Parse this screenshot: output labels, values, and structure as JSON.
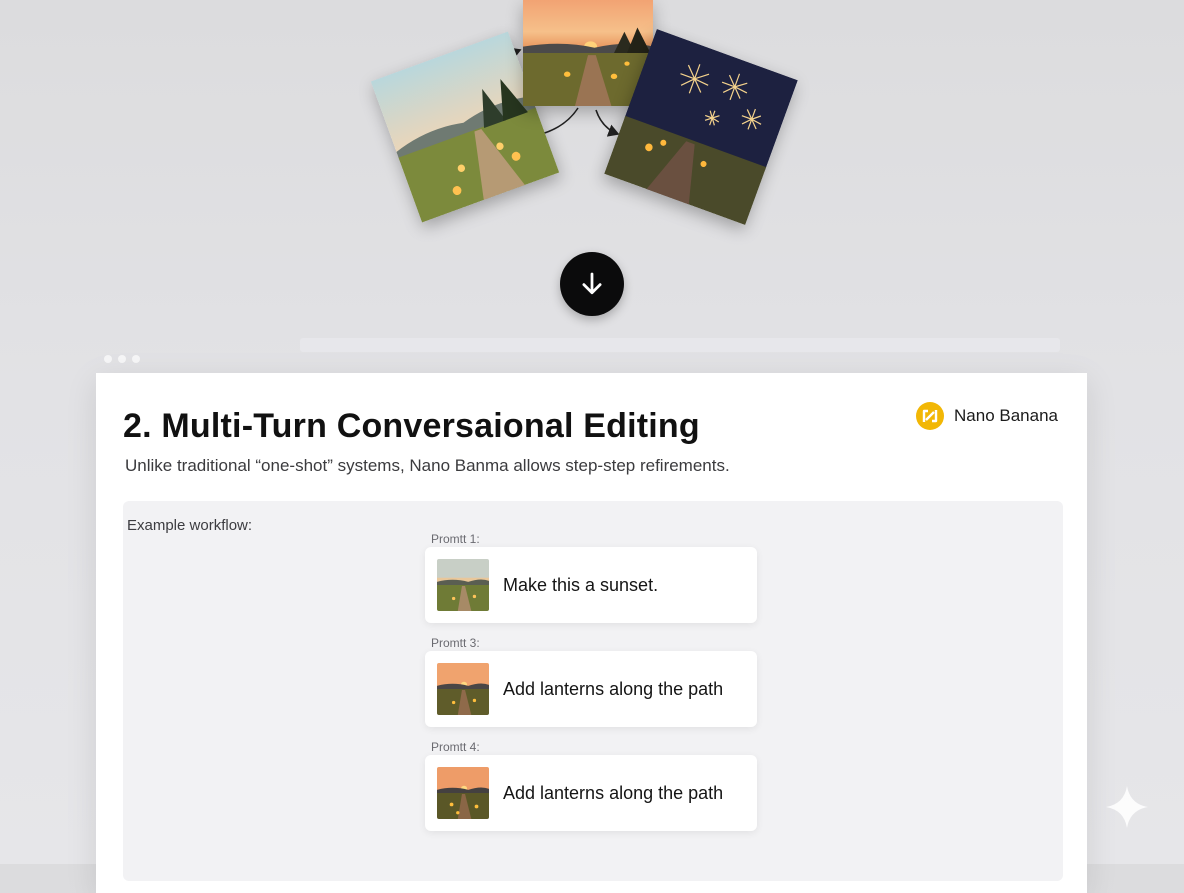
{
  "hero": {
    "images": [
      {
        "name": "original-photo"
      },
      {
        "name": "sunset-photo"
      },
      {
        "name": "fireworks-photo"
      }
    ],
    "down_icon": "arrow-down-icon"
  },
  "window": {
    "dots": 3
  },
  "card": {
    "title": "2. Multi-Turn Conversaional Editing",
    "brand": {
      "name": "Nano Banana",
      "icon": "nano-banana-logo-icon",
      "accent": "#f2b705"
    },
    "subtitle": "Unlike traditional “one-shot” systems, Nano Banma allows step-step refirements.",
    "workflow": {
      "label": "Example workflow:",
      "steps": [
        {
          "label": "Promtt 1:",
          "text": "Make this a sunset."
        },
        {
          "label": "Promtt 3:",
          "text": "Add lanterns along the path"
        },
        {
          "label": "Promtt 4:",
          "text": "Add lanterns along the path"
        }
      ]
    }
  },
  "colors": {
    "background": "#e0e0e3",
    "card": "#ffffff",
    "button": "#0b0b0c"
  },
  "watermark": {
    "icon": "sparkle-icon"
  }
}
